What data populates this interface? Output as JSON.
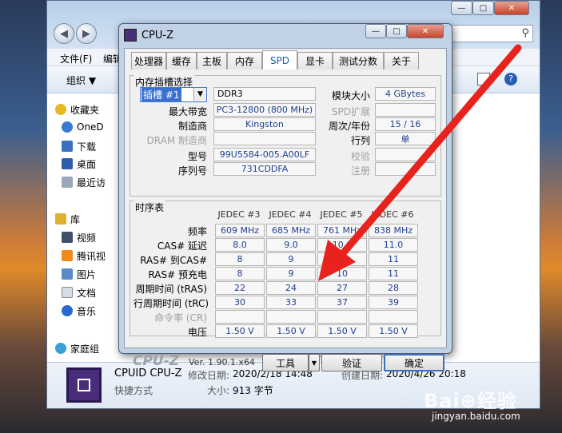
{
  "explorer": {
    "menu": [
      "文件(F)",
      "编辑"
    ],
    "toolbar_organize": "组织 ▼",
    "nav_items": [
      {
        "label": "收藏夹",
        "icon": "star-icon"
      },
      {
        "label": "OneD",
        "icon": "cloud-icon"
      },
      {
        "label": "下载",
        "icon": "download-folder-icon"
      },
      {
        "label": "桌面",
        "icon": "desktop-icon"
      },
      {
        "label": "最近访",
        "icon": "recent-icon"
      },
      {
        "label": "库",
        "icon": "library-icon"
      },
      {
        "label": "视频",
        "icon": "video-icon"
      },
      {
        "label": "腾讯视",
        "icon": "tencent-video-icon"
      },
      {
        "label": "图片",
        "icon": "picture-icon"
      },
      {
        "label": "文档",
        "icon": "document-icon"
      },
      {
        "label": "音乐",
        "icon": "music-icon"
      },
      {
        "label": "家庭组",
        "icon": "homegroup-icon"
      }
    ],
    "status": {
      "name": "CPUID CPU-Z",
      "modified_label": "修改日期:",
      "modified": "2020/2/18 14:48",
      "created_label": "创建日期:",
      "created": "2020/4/26 20:18",
      "type": "快捷方式",
      "size_label": "大小:",
      "size": "913 字节"
    }
  },
  "cpuz": {
    "title": "CPU-Z",
    "tabs": [
      "处理器",
      "缓存",
      "主板",
      "内存",
      "SPD",
      "显卡",
      "测试分数",
      "关于"
    ],
    "active_tab": "SPD",
    "slot_group": {
      "title": "内存插槽选择",
      "slot_selected": "插槽 #1",
      "type": "DDR3",
      "module_size_label": "模块大小",
      "module_size": "4 GBytes",
      "max_bw_label": "最大带宽",
      "max_bw": "PC3-12800 (800 MHz)",
      "spd_ext_label": "SPD扩展",
      "maker_label": "制造商",
      "maker": "Kingston",
      "week_year_label": "周次/年份",
      "week_year": "15 / 16",
      "dram_maker_label": "DRAM 制造商",
      "ranks_label": "行列",
      "ranks": "单",
      "part_label": "型号",
      "part": "99U5584-005.A00LF",
      "correction_label": "校验",
      "serial_label": "序列号",
      "serial": "731CDDFA",
      "registered_label": "注册"
    },
    "timing_group": {
      "title": "时序表",
      "columns": [
        "JEDEC #3",
        "JEDEC #4",
        "JEDEC #5",
        "JEDEC #6"
      ],
      "rows": [
        {
          "label": "频率",
          "values": [
            "609 MHz",
            "685 MHz",
            "761 MHz",
            "838 MHz"
          ]
        },
        {
          "label": "CAS# 延迟",
          "values": [
            "8.0",
            "9.0",
            "10.0",
            "11.0"
          ]
        },
        {
          "label": "RAS# 到CAS#",
          "values": [
            "8",
            "9",
            "10",
            "11"
          ]
        },
        {
          "label": "RAS# 预充电",
          "values": [
            "8",
            "9",
            "10",
            "11"
          ]
        },
        {
          "label": "周期时间 (tRAS)",
          "values": [
            "22",
            "24",
            "27",
            "28"
          ]
        },
        {
          "label": "行周期时间 (tRC)",
          "values": [
            "30",
            "33",
            "37",
            "39"
          ]
        },
        {
          "label": "命令率 (CR)",
          "values": [
            "",
            "",
            "",
            ""
          ]
        },
        {
          "label": "电压",
          "values": [
            "1.50 V",
            "1.50 V",
            "1.50 V",
            "1.50 V"
          ]
        }
      ]
    },
    "footer": {
      "brand": "CPU-Z",
      "version": "Ver. 1.90.1.x64",
      "tools_label": "工具",
      "validate_label": "验证",
      "ok_label": "确定"
    }
  },
  "watermark": "jingyan.baidu.com",
  "colors": {
    "arrow": "#e8231e",
    "value_text": "#1f3f8f",
    "active_tab": "#1f5fb0"
  }
}
